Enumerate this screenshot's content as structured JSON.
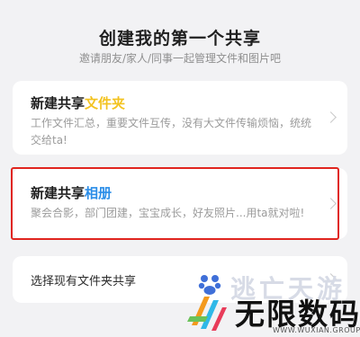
{
  "header": {
    "title": "创建我的第一个共享",
    "subtitle": "邀请朋友/家人/同事一起管理文件和图片吧"
  },
  "cards": [
    {
      "title_prefix": "新建共享",
      "title_accent": "文件夹",
      "accent_color": "#f3c320",
      "description": "工作文件汇总，重要文件互传，没有大文件传输烦恼，统统交给ta!"
    },
    {
      "title_prefix": "新建共享",
      "title_accent": "相册",
      "accent_color": "#2a8de8",
      "description": "聚会合影，部门团建，宝宝成长，好友照片...用ta就对啦!",
      "highlighted": true
    },
    {
      "label": "选择现有文件夹共享"
    }
  ],
  "watermark": {
    "top_text": "逃亡天游",
    "main_text": "无限数码",
    "url": "WWW.WUXIAN.GROUP"
  },
  "colors": {
    "background": "#f2f2f4",
    "highlight_border": "#e0251f"
  }
}
